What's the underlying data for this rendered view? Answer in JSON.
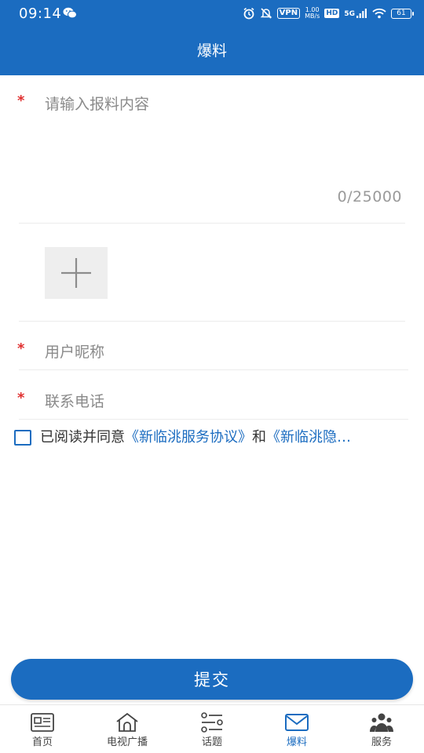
{
  "status_bar": {
    "time": "09:14",
    "vpn": "VPN",
    "speed_value": "1.00",
    "speed_unit": "MB/s",
    "hd": "HD",
    "network": "5G",
    "battery": "61"
  },
  "header": {
    "title": "爆料"
  },
  "form": {
    "required_mark": "*",
    "content_placeholder": "请输入报料内容",
    "char_counter": "0/25000",
    "nickname_placeholder": "用户昵称",
    "phone_placeholder": "联系电话"
  },
  "agreement": {
    "prefix": "已阅读并同意",
    "link_service": "《新临洮服务协议》",
    "connector": "和",
    "link_privacy": "《新临洮隐…"
  },
  "submit_label": "提交",
  "bottom_nav": {
    "items": [
      {
        "label": "首页",
        "icon": "news-icon"
      },
      {
        "label": "电视广播",
        "icon": "home-tv-icon"
      },
      {
        "label": "话题",
        "icon": "topic-list-icon"
      },
      {
        "label": "爆料",
        "icon": "mail-icon"
      },
      {
        "label": "服务",
        "icon": "people-icon"
      }
    ],
    "active_index": 3
  },
  "colors": {
    "primary": "#1b6cc0",
    "required": "#e03030",
    "placeholder": "#8a8a8a"
  }
}
